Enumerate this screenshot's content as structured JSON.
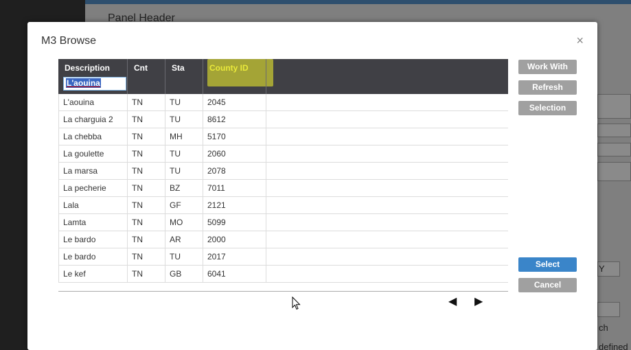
{
  "background": {
    "panel_header": "Panel Header",
    "text_a": "Y",
    "text_b": "ch",
    "text_c": "defined"
  },
  "modal": {
    "title": "M3 Browse",
    "close_label": "×"
  },
  "grid": {
    "columns": [
      "Description",
      "Cnt",
      "Sta",
      "County ID"
    ],
    "filter_value": "L'aouina",
    "rows": [
      [
        "L'aouina",
        "TN",
        "TU",
        "2045"
      ],
      [
        "La charguia 2",
        "TN",
        "TU",
        "8612"
      ],
      [
        "La chebba",
        "TN",
        "MH",
        "5170"
      ],
      [
        "La goulette",
        "TN",
        "TU",
        "2060"
      ],
      [
        "La marsa",
        "TN",
        "TU",
        "2078"
      ],
      [
        "La pecherie",
        "TN",
        "BZ",
        "7011"
      ],
      [
        "Lala",
        "TN",
        "GF",
        "2121"
      ],
      [
        "Lamta",
        "TN",
        "MO",
        "5099"
      ],
      [
        "Le bardo",
        "TN",
        "AR",
        "2000"
      ],
      [
        "Le bardo",
        "TN",
        "TU",
        "2017"
      ],
      [
        "Le kef",
        "TN",
        "GB",
        "6041"
      ]
    ]
  },
  "buttons": {
    "work_with": "Work With",
    "refresh": "Refresh",
    "selection": "Selection",
    "select": "Select",
    "cancel": "Cancel"
  },
  "pager": {
    "prev": "◀",
    "next": "▶"
  },
  "colors": {
    "accent": "#3a85c9",
    "header_bg": "#404045",
    "highlight": "#f5f52a"
  }
}
